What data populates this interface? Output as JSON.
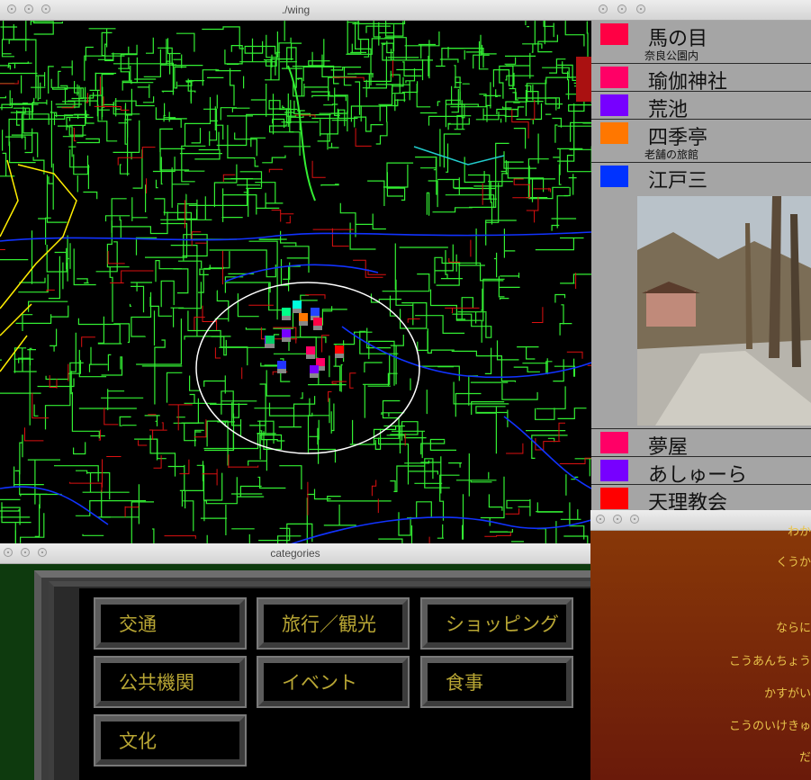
{
  "map_window": {
    "title": "./wing"
  },
  "list_window": {
    "items": [
      {
        "label": "馬の目",
        "sub": "奈良公園内",
        "color": "#ff0044"
      },
      {
        "label": "瑜伽神社",
        "sub": "",
        "color": "#ff0066"
      },
      {
        "label": "荒池",
        "sub": "",
        "color": "#7700ff"
      },
      {
        "label": "四季亭",
        "sub": "老舗の旅館",
        "color": "#ff7700"
      },
      {
        "label": "江戸三",
        "sub": "",
        "color": "#0033ff"
      },
      {
        "label": "夢屋",
        "sub": "",
        "color": "#ff0066"
      },
      {
        "label": "あしゅーら",
        "sub": "",
        "color": "#7700ff"
      },
      {
        "label": "天理教会",
        "sub": "",
        "color": "#ff0000"
      }
    ]
  },
  "categories_window": {
    "title": "categories",
    "buttons": [
      "交通",
      "旅行／観光",
      "ショッピング",
      "公共機関",
      "イベント",
      "食事",
      "文化"
    ]
  },
  "text_window": {
    "lines": [
      "わか",
      "くうか",
      "ならに",
      "こうあんちょう",
      "かすがい",
      "こうのいけきゅ",
      "だ"
    ]
  }
}
